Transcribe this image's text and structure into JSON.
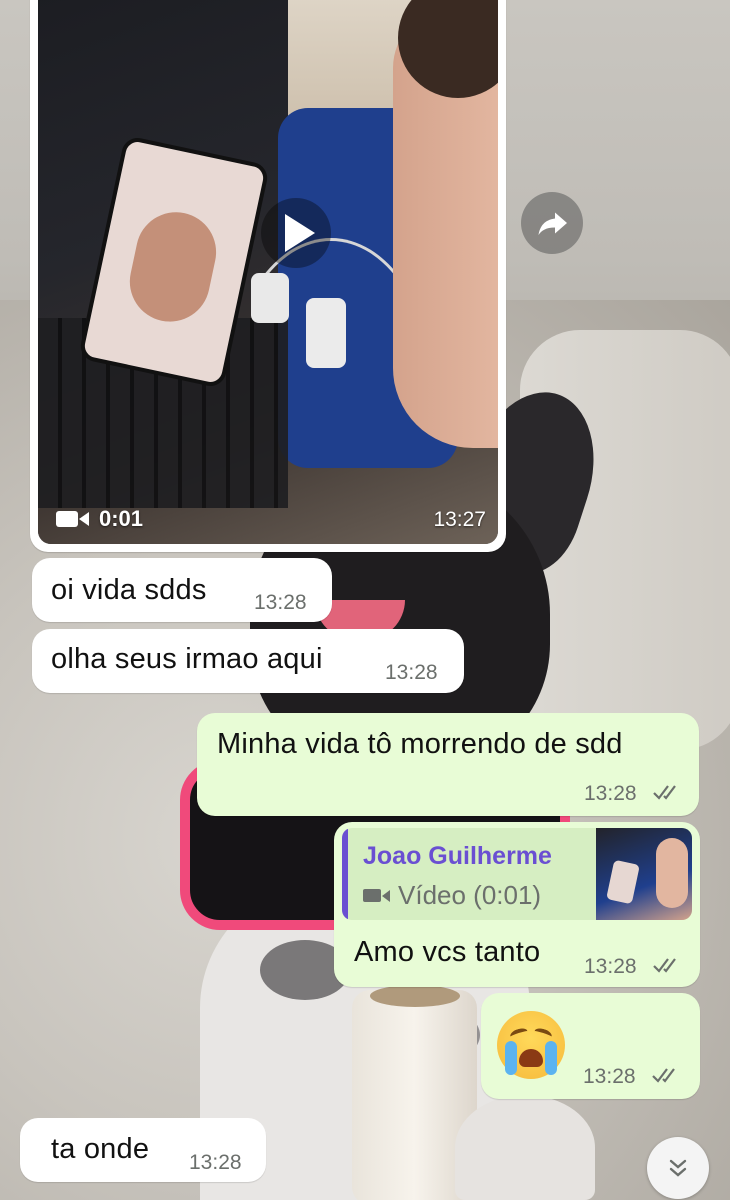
{
  "video_message": {
    "duration": "0:01",
    "time": "13:27",
    "play_icon": "play-icon",
    "video_icon": "video-camera-icon"
  },
  "forward_icon": "forward-arrow-icon",
  "messages": [
    {
      "direction": "in",
      "text": "oi vida sdds",
      "time": "13:28"
    },
    {
      "direction": "in",
      "text": "olha seus irmao aqui",
      "time": "13:28"
    },
    {
      "direction": "out",
      "text": "Minha vida tô morrendo de sdd",
      "time": "13:28",
      "status": "read"
    },
    {
      "direction": "out",
      "quote": {
        "author": "Joao Guilherme",
        "media_label": "Vídeo (0:01)"
      },
      "text": "Amo vcs tanto",
      "time": "13:28",
      "status": "read"
    },
    {
      "direction": "out",
      "emoji": "😭",
      "time": "13:28",
      "status": "read"
    },
    {
      "direction": "in",
      "text": "ta onde",
      "time": "13:28"
    }
  ],
  "scroll_down_icon": "double-chevron-down-icon",
  "colors": {
    "incoming_bubble": "#ffffff",
    "outgoing_bubble": "#e8fcd6",
    "quote_accent": "#6a4fd2",
    "read_ticks": "#6b6f6c"
  }
}
